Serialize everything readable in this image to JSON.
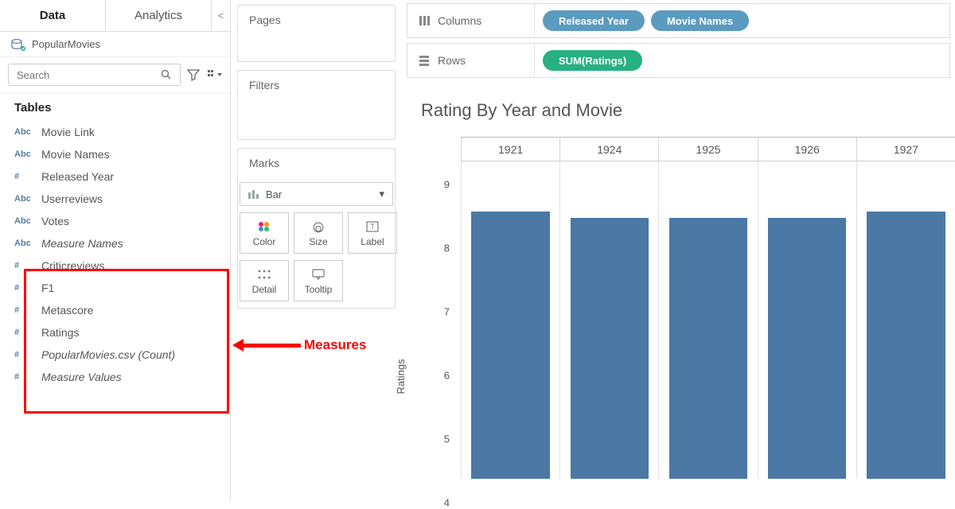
{
  "sidebar": {
    "tab_data": "Data",
    "tab_analytics": "Analytics",
    "collapse": "<",
    "datasource": "PopularMovies",
    "search_placeholder": "Search",
    "tables_label": "Tables",
    "fields": [
      {
        "type": "Abc",
        "label": "Movie Link",
        "italic": false,
        "num": false
      },
      {
        "type": "Abc",
        "label": "Movie Names",
        "italic": false,
        "num": false
      },
      {
        "type": "#",
        "label": "Released Year",
        "italic": false,
        "num": true
      },
      {
        "type": "Abc",
        "label": "Userreviews",
        "italic": false,
        "num": false
      },
      {
        "type": "Abc",
        "label": "Votes",
        "italic": false,
        "num": false
      },
      {
        "type": "Abc",
        "label": "Measure Names",
        "italic": true,
        "num": false
      },
      {
        "type": "#",
        "label": "Criticreviews",
        "italic": false,
        "num": true
      },
      {
        "type": "#",
        "label": "F1",
        "italic": false,
        "num": true
      },
      {
        "type": "#",
        "label": "Metascore",
        "italic": false,
        "num": true
      },
      {
        "type": "#",
        "label": "Ratings",
        "italic": false,
        "num": true
      },
      {
        "type": "#",
        "label": "PopularMovies.csv (Count)",
        "italic": true,
        "num": true
      },
      {
        "type": "#",
        "label": "Measure Values",
        "italic": true,
        "num": true
      }
    ]
  },
  "cards": {
    "pages": "Pages",
    "filters": "Filters",
    "marks": "Marks",
    "mark_type": "Bar",
    "color": "Color",
    "size": "Size",
    "label": "Label",
    "detail": "Detail",
    "tooltip": "Tooltip"
  },
  "shelves": {
    "columns": "Columns",
    "rows": "Rows",
    "col_pill1": "Released Year",
    "col_pill2": "Movie Names",
    "row_pill1": "SUM(Ratings)"
  },
  "viz": {
    "title": "Rating By Year and Movie",
    "y_label": "Ratings",
    "y_ticks": [
      9,
      8,
      7,
      6,
      5,
      4
    ],
    "years": [
      "1921",
      "1924",
      "1925",
      "1926",
      "1927"
    ]
  },
  "chart_data": {
    "type": "bar",
    "title": "Rating By Year and Movie",
    "xlabel": "Released Year / Movie Names",
    "ylabel": "Ratings",
    "ylim": [
      4,
      9
    ],
    "categories": [
      "1921",
      "1924",
      "1925",
      "1926",
      "1927"
    ],
    "values": [
      8.2,
      8.1,
      8.1,
      8.1,
      8.2
    ]
  },
  "annotation": {
    "text": "Measures"
  },
  "colors": {
    "dim_pill": "#5b9bc0",
    "meas_pill": "#27b082",
    "bar": "#4b78a5",
    "highlight": "#ff0000"
  }
}
